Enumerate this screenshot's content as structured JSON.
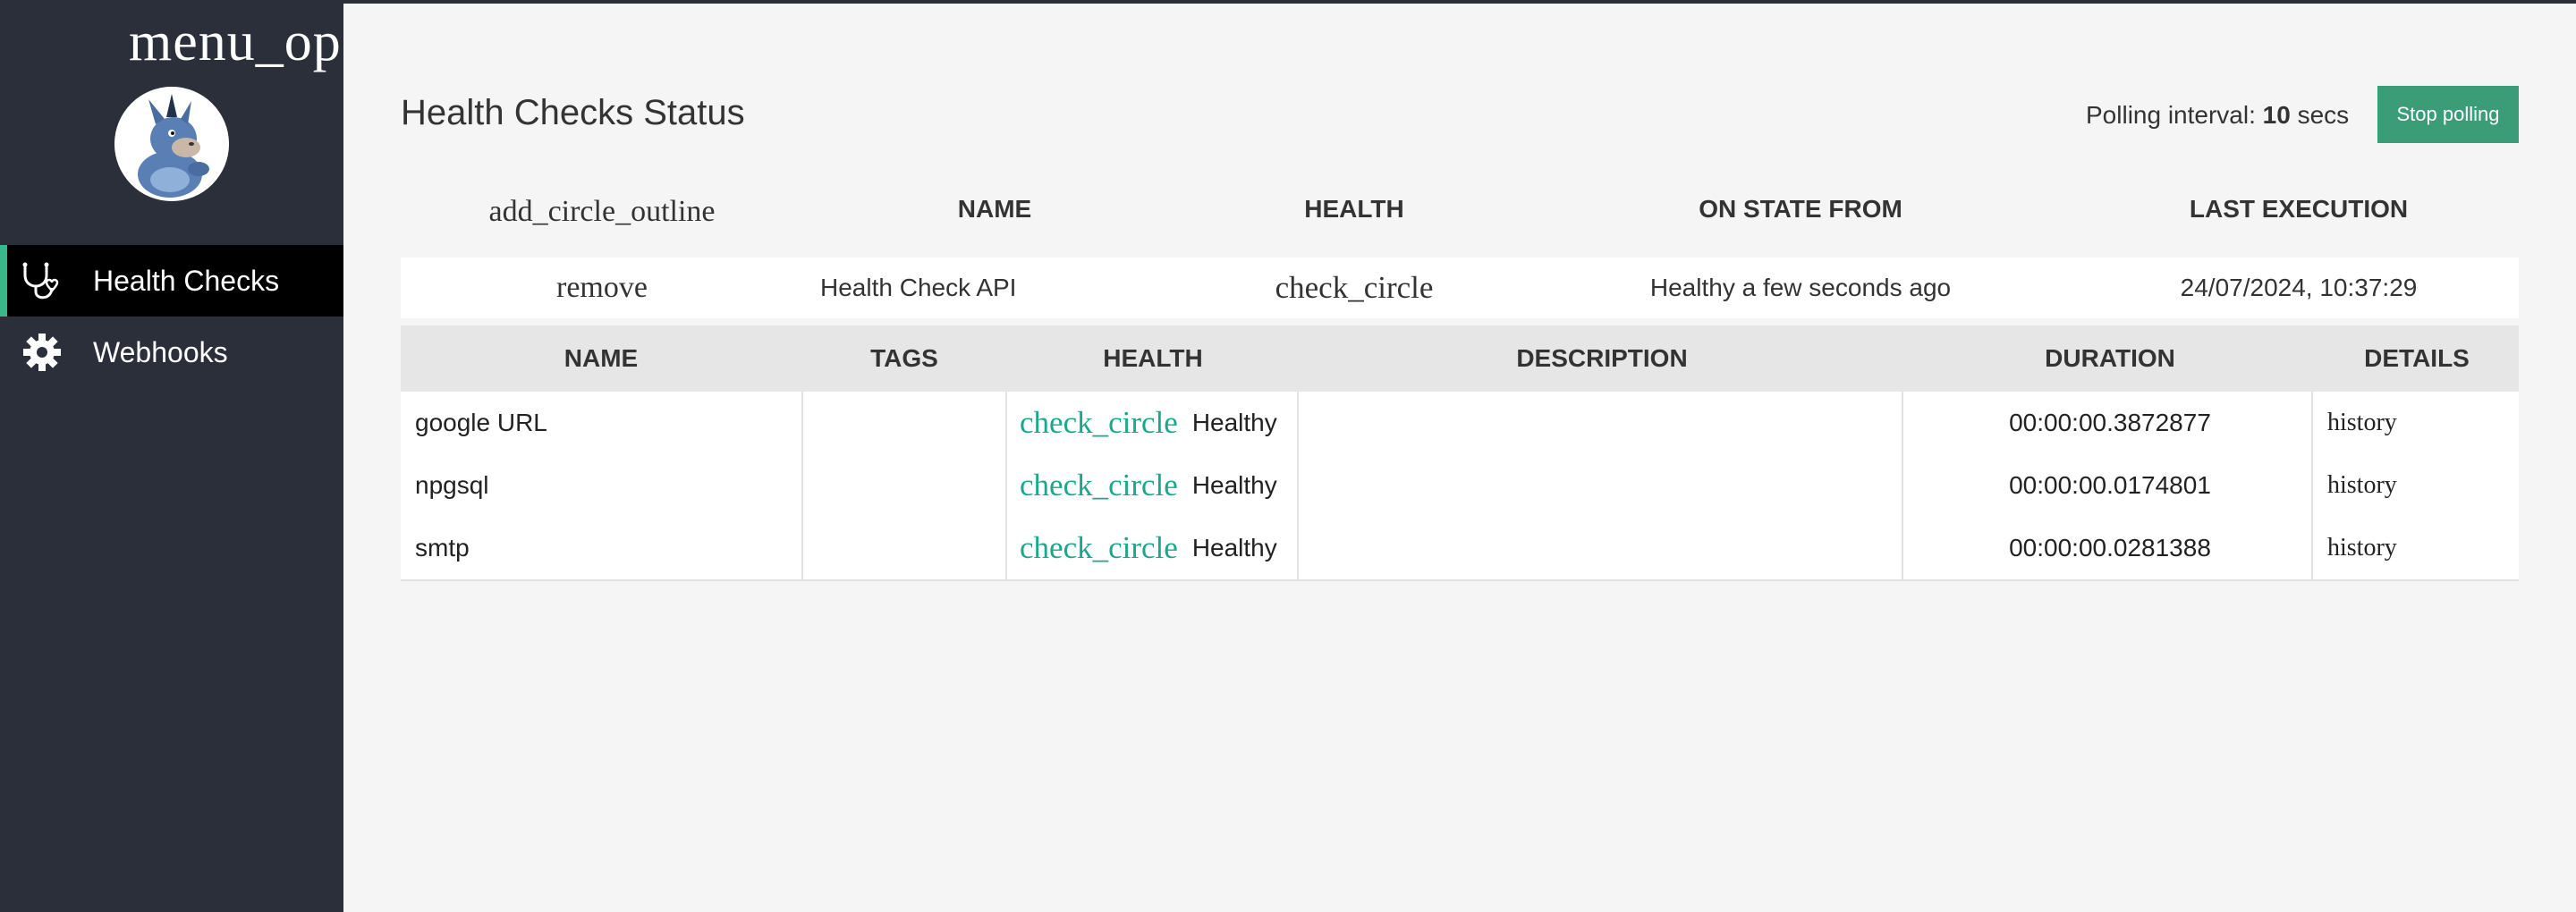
{
  "sidebar": {
    "menu_icon_text": "menu_op",
    "items": [
      {
        "label": "Health Checks",
        "icon": "stethoscope-icon",
        "active": true
      },
      {
        "label": "Webhooks",
        "icon": "gear-icon",
        "active": false
      }
    ]
  },
  "header": {
    "title": "Health Checks Status",
    "polling_prefix": "Polling interval:",
    "polling_value": "10",
    "polling_unit": "secs",
    "stop_button": "Stop polling"
  },
  "outer_table": {
    "expand_all_icon": "add_circle_outline",
    "columns": [
      "NAME",
      "HEALTH",
      "ON STATE FROM",
      "LAST EXECUTION"
    ],
    "row": {
      "collapse_icon": "remove",
      "name": "Health Check API",
      "health_icon": "check_circle",
      "on_state_from": "Healthy a few seconds ago",
      "last_execution": "24/07/2024, 10:37:29"
    }
  },
  "inner_table": {
    "columns": [
      "NAME",
      "TAGS",
      "HEALTH",
      "DESCRIPTION",
      "DURATION",
      "DETAILS"
    ],
    "rows": [
      {
        "name": "google URL",
        "tags": "",
        "health_icon": "check_circle",
        "health": "Healthy",
        "description": "",
        "duration": "00:00:00.3872877",
        "details": "history"
      },
      {
        "name": "npgsql",
        "tags": "",
        "health_icon": "check_circle",
        "health": "Healthy",
        "description": "",
        "duration": "00:00:00.0174801",
        "details": "history"
      },
      {
        "name": "smtp",
        "tags": "",
        "health_icon": "check_circle",
        "health": "Healthy",
        "description": "",
        "duration": "00:00:00.0281388",
        "details": "history"
      }
    ]
  },
  "colors": {
    "sidebar_bg": "#2b2f3a",
    "accent_green": "#3a9d78",
    "healthy_text": "#1aa88a",
    "active_item_bg": "#000000"
  }
}
